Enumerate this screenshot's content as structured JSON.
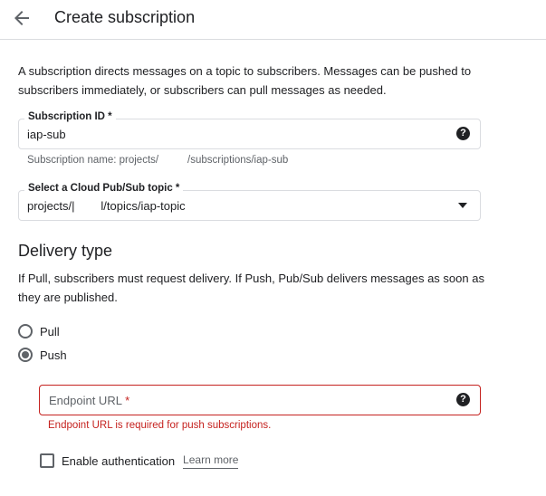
{
  "header": {
    "back_icon": "arrow-back-icon",
    "title": "Create subscription"
  },
  "intro": "A subscription directs messages on a topic to subscribers. Messages can be pushed to subscribers immediately, or subscribers can pull messages as needed.",
  "subscription_id": {
    "label": "Subscription ID *",
    "value": "iap-sub",
    "help_icon": "help-icon",
    "hint": "Subscription name: projects/          /subscriptions/iap-sub"
  },
  "topic": {
    "label": "Select a Cloud Pub/Sub topic *",
    "value": "projects/|        l/topics/iap-topic",
    "dropdown_icon": "dropdown-arrow-icon"
  },
  "delivery": {
    "title": "Delivery type",
    "description": "If Pull, subscribers must request delivery. If Push, Pub/Sub delivers messages as soon as they are published.",
    "options": [
      {
        "label": "Pull",
        "checked": false
      },
      {
        "label": "Push",
        "checked": true
      }
    ]
  },
  "endpoint": {
    "placeholder": "Endpoint URL",
    "required_mark": "*",
    "help_icon": "help-icon",
    "error": "Endpoint URL is required for push subscriptions."
  },
  "auth": {
    "label": "Enable authentication",
    "checked": false,
    "learn_more": "Learn more"
  },
  "colors": {
    "error": "#c5221f",
    "border": "#dadce0",
    "text": "#202124",
    "secondary_text": "#5f6368"
  }
}
